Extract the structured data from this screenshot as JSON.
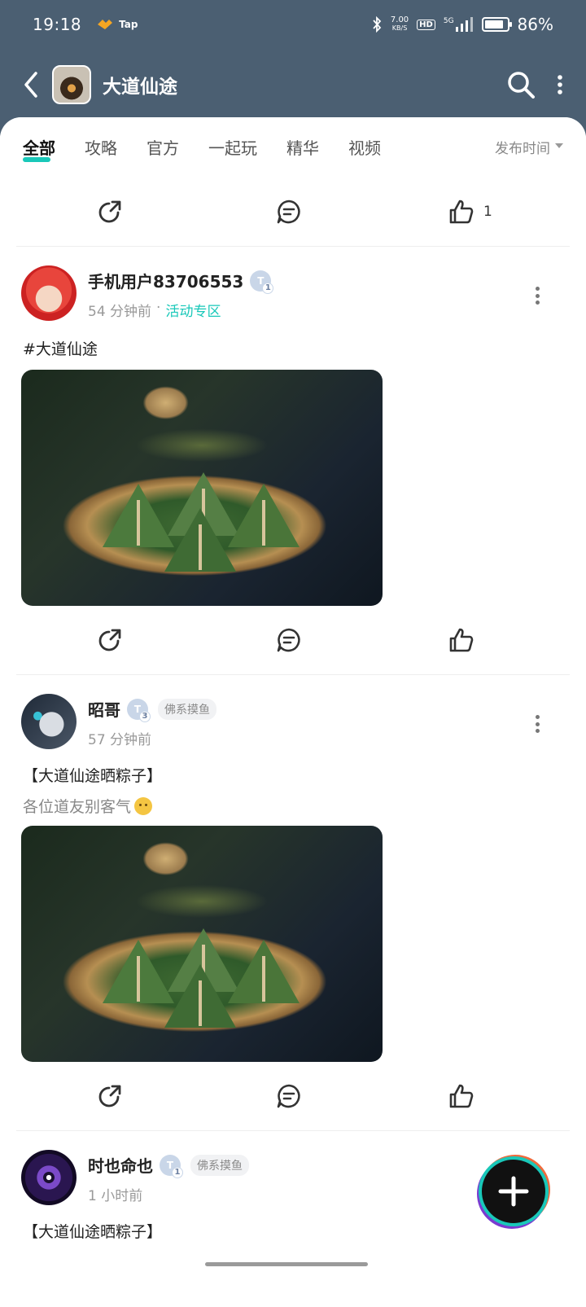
{
  "status": {
    "time": "19:18",
    "app_label": "Tap",
    "net_speed_value": "7.00",
    "net_speed_unit": "KB/S",
    "hd": "HD",
    "signal": "5G",
    "battery_pct": "86%",
    "battery_level": 0.86
  },
  "header": {
    "title": "大道仙途"
  },
  "tabs": {
    "items": [
      "全部",
      "攻略",
      "官方",
      "一起玩",
      "精华",
      "视频"
    ],
    "sort_label": "发布时间"
  },
  "posts": [
    {
      "likes": "1"
    },
    {
      "username": "手机用户83706553",
      "level": "1",
      "time": "54 分钟前",
      "zone": "活动专区",
      "title": "#大道仙途"
    },
    {
      "username": "昭哥",
      "level": "3",
      "tag": "佛系摸鱼",
      "time": "57 分钟前",
      "title": "【大道仙途晒粽子】",
      "subtitle": "各位道友别客气"
    },
    {
      "username": "时也命也",
      "level": "1",
      "tag": "佛系摸鱼",
      "time": "1 小时前",
      "title": "【大道仙途晒粽子】"
    }
  ],
  "colors": {
    "accent": "#19c8b9",
    "header_bg": "#4b5f72"
  },
  "icons": {
    "back": "back-arrow-icon",
    "search": "search-icon",
    "more": "more-vertical-icon",
    "share": "share-icon",
    "comment": "comment-icon",
    "like": "thumbs-up-icon",
    "add": "plus-icon"
  }
}
